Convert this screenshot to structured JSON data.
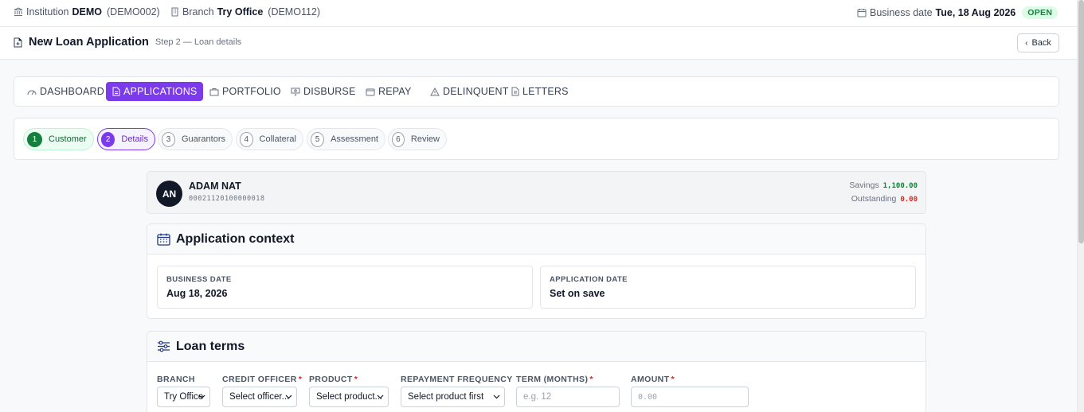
{
  "topbar": {
    "institution_label": "Institution",
    "institution_name": "DEMO",
    "institution_code": "(DEMO002)",
    "branch_label": "Branch",
    "branch_name": "Try Office",
    "branch_code": "(DEMO112)",
    "business_date_label": "Business date",
    "business_date_value": "Tue, 18 Aug 2026",
    "status_badge": "OPEN"
  },
  "page_header": {
    "title": "New Loan Application",
    "subtitle": "Step 2 — Loan details",
    "back_label": "Back"
  },
  "nav": {
    "tabs": [
      {
        "label": "DASHBOARD",
        "icon": "gauge-icon",
        "active": false
      },
      {
        "label": "APPLICATIONS",
        "icon": "document-icon",
        "active": true
      },
      {
        "label": "PORTFOLIO",
        "icon": "briefcase-icon",
        "active": false
      },
      {
        "label": "DISBURSE",
        "icon": "cash-icon",
        "active": false
      },
      {
        "label": "REPAY",
        "icon": "wallet-icon",
        "active": false
      },
      {
        "label": "DELINQUENT",
        "icon": "warning-icon",
        "active": false
      },
      {
        "label": "LETTERS",
        "icon": "letter-icon",
        "active": false
      }
    ]
  },
  "stepper": {
    "steps": [
      {
        "num": "1",
        "label": "Customer",
        "state": "done"
      },
      {
        "num": "2",
        "label": "Details",
        "state": "active"
      },
      {
        "num": "3",
        "label": "Guarantors",
        "state": "pending"
      },
      {
        "num": "4",
        "label": "Collateral",
        "state": "pending"
      },
      {
        "num": "5",
        "label": "Assessment",
        "state": "pending"
      },
      {
        "num": "6",
        "label": "Review",
        "state": "pending"
      }
    ]
  },
  "customer": {
    "initials": "AN",
    "name": "ADAM NAT",
    "account": "00021120100000018",
    "savings_label": "Savings",
    "savings_value": "1,100.00",
    "outstanding_label": "Outstanding",
    "outstanding_value": "0.00",
    "colors": {
      "positive": "#15803d",
      "negative": "#dc2626"
    }
  },
  "app_context": {
    "title": "Application context",
    "icon": "calendar-icon",
    "business_date_label": "BUSINESS DATE",
    "business_date_value": "Aug 18, 2026",
    "application_date_label": "APPLICATION DATE",
    "application_date_value": "Set on save"
  },
  "loan_terms": {
    "title": "Loan terms",
    "icon": "sliders-icon",
    "branch": {
      "label": "BRANCH",
      "value": "Try Office"
    },
    "credit_officer": {
      "label": "CREDIT OFFICER",
      "required": "*",
      "value": "Select officer..."
    },
    "product": {
      "label": "PRODUCT",
      "required": "*",
      "value": "Select product..."
    },
    "repayment_frequency": {
      "label": "REPAYMENT FREQUENCY",
      "value": "Select product first"
    },
    "term": {
      "label": "TERM (MONTHS)",
      "required": "*",
      "placeholder": "e.g. 12"
    },
    "amount": {
      "label": "AMOUNT",
      "required": "*",
      "placeholder": "0.00"
    }
  },
  "theme": {
    "accent": "#7c3aed",
    "success": "#15803d",
    "danger": "#dc2626"
  }
}
